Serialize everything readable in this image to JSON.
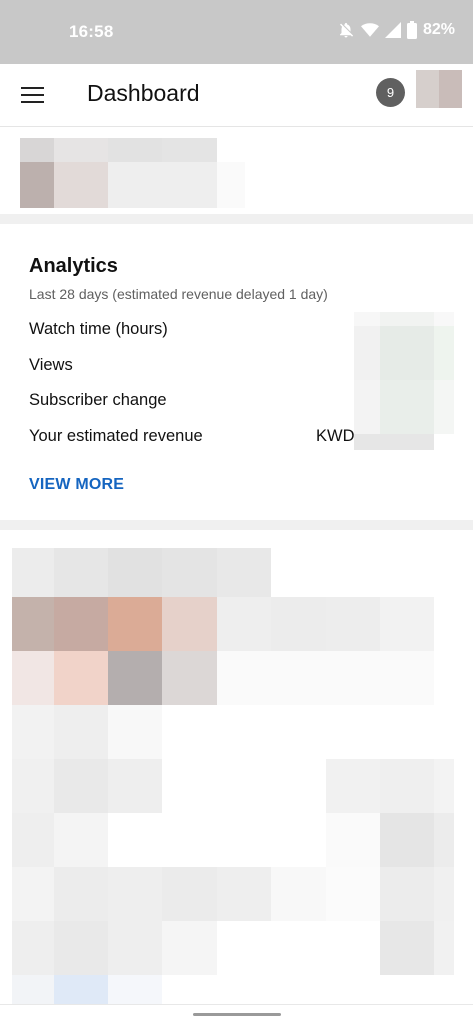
{
  "status_bar": {
    "time": "16:58",
    "battery": "82%",
    "icons": [
      "bell-off-icon",
      "wifi-icon",
      "signal-icon",
      "battery-icon"
    ]
  },
  "header": {
    "title": "Dashboard",
    "menu_icon": "hamburger-menu-icon",
    "notification_count": "9"
  },
  "analytics": {
    "title": "Analytics",
    "subtitle": "Last 28 days (estimated revenue delayed 1 day)",
    "metrics": [
      {
        "label": "Watch time (hours)"
      },
      {
        "label": "Views"
      },
      {
        "label": "Subscriber change"
      },
      {
        "label": "Your estimated revenue"
      }
    ],
    "currency": "KWD",
    "view_more": "VIEW MORE"
  },
  "colors": {
    "accent": "#1565c0",
    "status_bar": "#c8c8c8",
    "badge": "#606060"
  }
}
